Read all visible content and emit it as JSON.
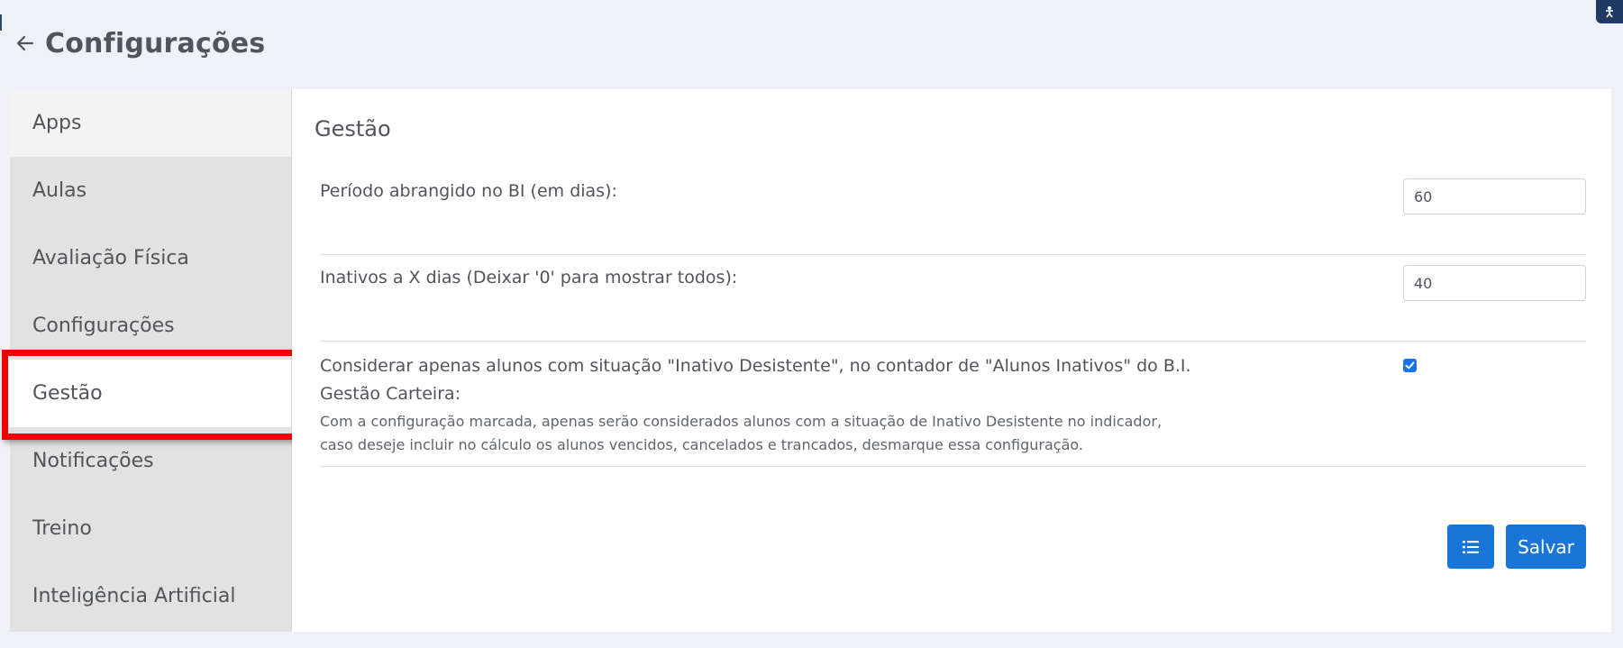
{
  "header": {
    "title": "Configurações",
    "back_icon": "arrow-left-icon"
  },
  "sidebar": {
    "items": [
      {
        "label": "Apps"
      },
      {
        "label": "Aulas"
      },
      {
        "label": "Avaliação Física"
      },
      {
        "label": "Configurações"
      },
      {
        "label": "Gestão"
      },
      {
        "label": "Notificações"
      },
      {
        "label": "Treino"
      },
      {
        "label": "Inteligência Artificial"
      }
    ],
    "active": "Gestão"
  },
  "main": {
    "section_title": "Gestão",
    "fields": [
      {
        "label": "Período abrangido no BI (em dias):",
        "value": "60"
      },
      {
        "label": "Inativos a X dias (Deixar '0' para mostrar todos):",
        "value": "40"
      }
    ],
    "option": {
      "label": "Considerar apenas alunos com situação \"Inativo Desistente\", no contador de \"Alunos Inativos\" do B.I.",
      "subtitle": "Gestão Carteira:",
      "description": "Com a configuração marcada, apenas serão considerados alunos com a situação de Inativo Desistente no indicador, caso deseje incluir no cálculo os alunos vencidos, cancelados e trancados, desmarque essa configuração.",
      "checked": true
    },
    "buttons": {
      "list_icon": "list-icon",
      "save_label": "Salvar"
    }
  },
  "colors": {
    "accent": "#1976d8",
    "highlight": "#ee0000",
    "background": "#eef1f6"
  }
}
